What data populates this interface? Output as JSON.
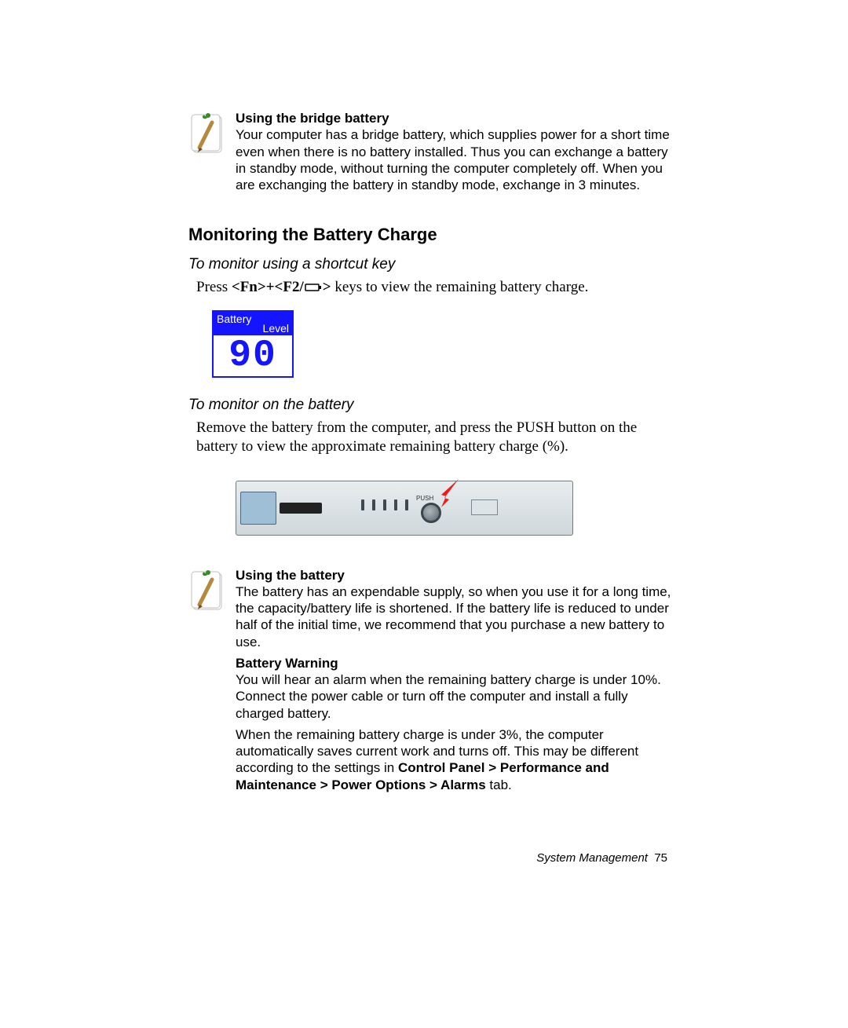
{
  "note1": {
    "title": "Using the bridge battery",
    "text": "Your computer has a bridge battery, which supplies power for a short time even when there is no battery installed. Thus you can exchange a battery in standby mode, without turning the computer completely off. When you are exchanging the battery in standby mode, exchange in 3 minutes."
  },
  "section_heading": "Monitoring the Battery Charge",
  "sub1": {
    "heading": "To monitor using a shortcut key",
    "press_pre": "Press ",
    "keys_a": "<Fn>+<F2/",
    "keys_b": ">",
    "press_post": " keys to view the remaining battery charge."
  },
  "battery_level": {
    "label1": "Battery",
    "label2": "Level",
    "value": "90"
  },
  "sub2": {
    "heading": "To monitor on the battery",
    "text": "Remove the battery from the computer, and press the PUSH button on the battery to view the approximate remaining battery charge (%)."
  },
  "battery_illustration": {
    "push_label": "PUSH"
  },
  "note2": {
    "title1": "Using the battery",
    "text1": "The battery has an expendable supply, so when you use it for a long time, the capacity/battery life is shortened. If the battery life is reduced to under half of the initial time, we recommend that you purchase a new battery to use.",
    "title2": "Battery Warning",
    "text2a": "You will hear an alarm when the remaining battery charge is under 10%. Connect the power cable or turn off the computer and install a fully charged battery.",
    "text2b_pre": "When the remaining battery charge is under 3%, the computer automatically saves current work and turns off. This may be different according to the settings in ",
    "text2b_bold": "Control Panel > Performance and Maintenance > Power Options > Alarms",
    "text2b_post": " tab."
  },
  "footer": {
    "section": "System Management",
    "page": "75"
  }
}
